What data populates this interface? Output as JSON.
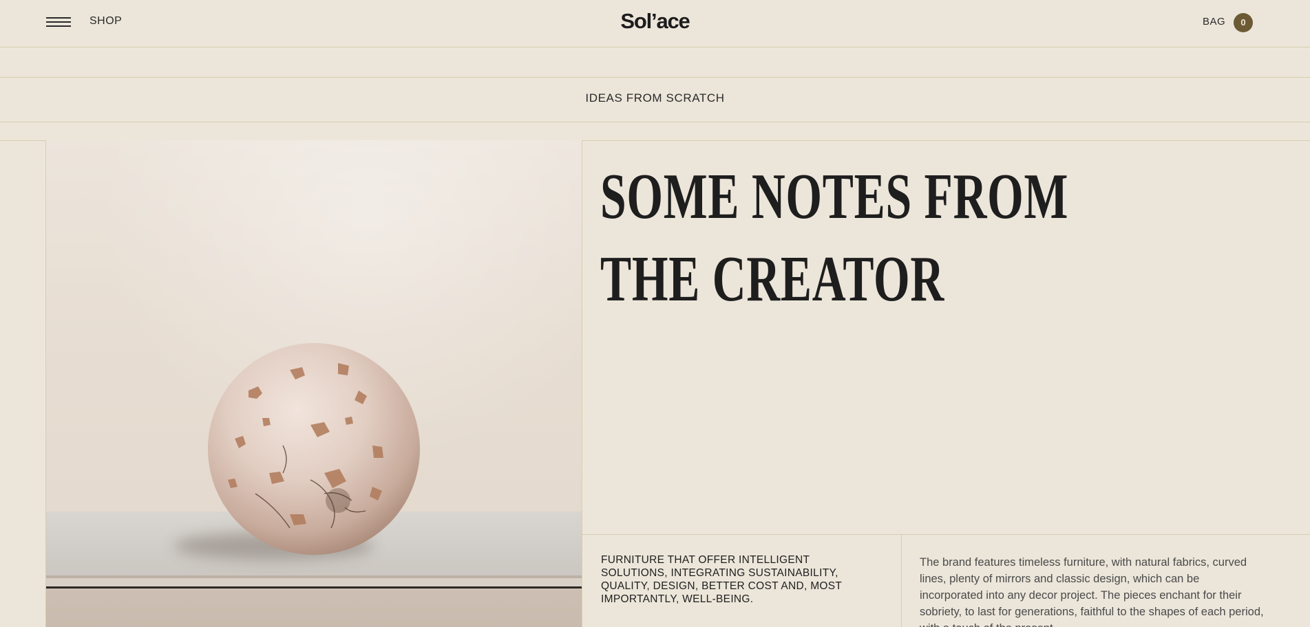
{
  "header": {
    "shop_label": "SHOP",
    "logo": "Sol’ace",
    "bag_label": "BAG",
    "bag_count": "0"
  },
  "banner": {
    "text": "IDEAS FROM SCRATCH"
  },
  "hero": {
    "headline_line1": "SOME NOTES FROM",
    "headline_line2": "THE CREATOR",
    "image_subject": "sphere-on-shelf"
  },
  "details": {
    "tagline": "FURNITURE THAT OFFER INTELLIGENT SOLUTIONS, INTEGRATING SUSTAINABILITY, QUALITY, DESIGN, BETTER COST AND, MOST IMPORTANTLY, WELL-BEING.",
    "description": "The brand features timeless furniture, with natural fabrics, curved lines, plenty of mirrors and classic design, which can be incorporated into any decor project. The pieces enchant for their sobriety, to last for generations, faithful to the shapes of each period, with a touch of the present."
  },
  "colors": {
    "background": "#ece6da",
    "line": "#d5ceb1",
    "accent": "#6b5a34",
    "text": "#1e1e1e"
  },
  "icons": {
    "menu": "hamburger-icon"
  }
}
